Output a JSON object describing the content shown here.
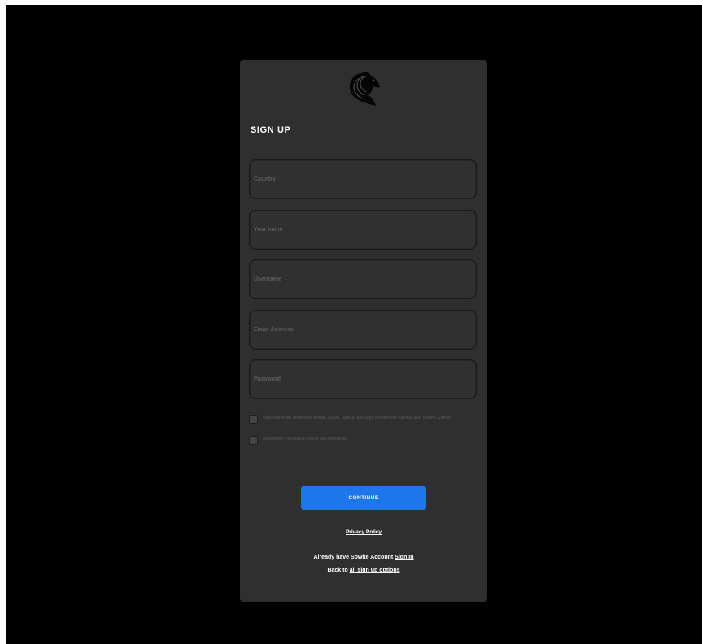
{
  "form": {
    "title": "SIGN UP",
    "logo_icon": "horse-head-icon",
    "fields": {
      "country": {
        "placeholder": "Country",
        "value": ""
      },
      "name": {
        "placeholder": "Your name",
        "value": ""
      },
      "username": {
        "placeholder": "Username",
        "value": ""
      },
      "email": {
        "placeholder": "Email Address",
        "value": ""
      },
      "password": {
        "placeholder": "Password",
        "value": ""
      }
    },
    "checkboxes": {
      "news": "Saya bersedia menerima berita, survei, update dan juga penawaran spesial dari Sowite Games",
      "terms": "Saya telah membaca syarat dan ketentuan"
    },
    "continue_label": "CONTINUE",
    "privacy_label": "Privacy Policy",
    "signin_prefix": "Already have Sowite Account",
    "signin_link": "Sign In",
    "back_prefix": "Back to",
    "back_link": "all sign up options"
  },
  "colors": {
    "background": "#000000",
    "card": "#2f2f2f",
    "accent": "#1c76ec",
    "text": "#ffffff"
  }
}
